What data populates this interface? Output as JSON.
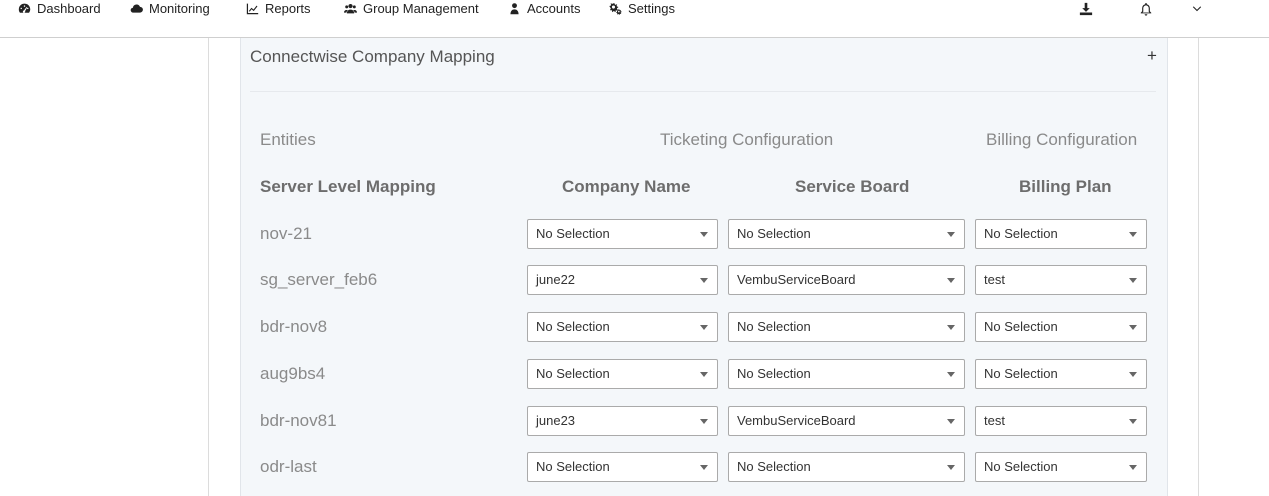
{
  "nav": {
    "items": [
      {
        "label": "Dashboard",
        "icon": "dashboard-icon"
      },
      {
        "label": "Monitoring",
        "icon": "cloud-icon"
      },
      {
        "label": "Reports",
        "icon": "line-chart-icon"
      },
      {
        "label": "Group Management",
        "icon": "users-icon"
      },
      {
        "label": "Accounts",
        "icon": "user-icon"
      },
      {
        "label": "Settings",
        "icon": "gears-icon"
      }
    ]
  },
  "panel": {
    "title": "Connectwise Company Mapping",
    "toggle": "+"
  },
  "sections": {
    "entities": "Entities",
    "ticketing": "Ticketing Configuration",
    "billing": "Billing Configuration"
  },
  "columns": {
    "server": "Server Level Mapping",
    "company": "Company Name",
    "board": "Service Board",
    "plan": "Billing Plan"
  },
  "rows": [
    {
      "name": "nov-21",
      "company": "No Selection",
      "board": "No Selection",
      "plan": "No Selection"
    },
    {
      "name": "sg_server_feb6",
      "company": "june22",
      "board": "VembuServiceBoard",
      "plan": "test"
    },
    {
      "name": "bdr-nov8",
      "company": "No Selection",
      "board": "No Selection",
      "plan": "No Selection"
    },
    {
      "name": "aug9bs4",
      "company": "No Selection",
      "board": "No Selection",
      "plan": "No Selection"
    },
    {
      "name": "bdr-nov81",
      "company": "june23",
      "board": "VembuServiceBoard",
      "plan": "test"
    },
    {
      "name": "odr-last",
      "company": "No Selection",
      "board": "No Selection",
      "plan": "No Selection"
    }
  ]
}
